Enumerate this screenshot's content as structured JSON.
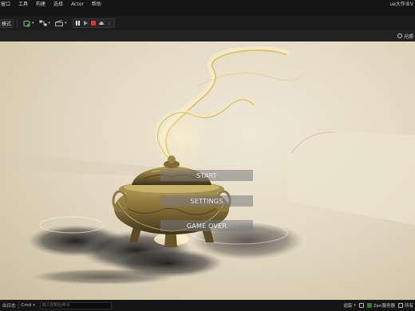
{
  "menubar": {
    "items": [
      "窗口",
      "工具",
      "构建",
      "选择",
      "Actor",
      "帮助"
    ],
    "project_name": "ue大作业V"
  },
  "toolbar": {
    "mode_label": "模式",
    "play_controls": {
      "pause_icon": "pause-icon",
      "step_icon": "step-frame-icon",
      "stop_icon": "stop-icon",
      "eject_icon": "eject-icon"
    }
  },
  "viewport_header": {
    "lighting_label": "光照"
  },
  "game_menu": {
    "start": "START",
    "settings": "SETTINGS",
    "game_over": "GAME OVER"
  },
  "statusbar": {
    "output_log": "出日志",
    "cmd_label": "Cmd",
    "console_placeholder": "输入控制台命令",
    "trace": "追踪",
    "zen": "Zen服务器",
    "all_saved": "所有"
  },
  "colors": {
    "stop_red": "#e0322f",
    "menu_button_bg": "#787880"
  }
}
